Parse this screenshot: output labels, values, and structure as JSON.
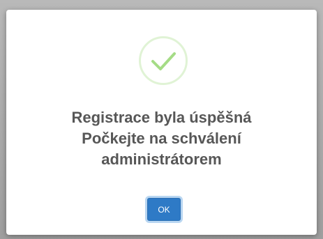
{
  "dialog": {
    "icon": "success-checkmark-icon",
    "message_lines": [
      "Registrace byla úspěšná",
      "Počkejte na schválení",
      "administrátorem"
    ],
    "ok_label": "OK"
  },
  "colors": {
    "check": "#a5dc86",
    "check_ring": "#d9f0cb",
    "text": "#575757",
    "button": "#2e7ac6",
    "overlay": "#a9a9a9"
  }
}
